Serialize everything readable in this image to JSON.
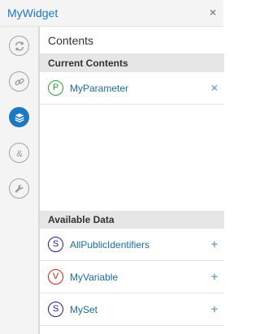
{
  "window": {
    "title": "MyWidget",
    "close_symbol": "×"
  },
  "nav": [
    {
      "name": "refresh-icon",
      "active": false
    },
    {
      "name": "link-icon",
      "active": false
    },
    {
      "name": "layers-icon",
      "active": true
    },
    {
      "name": "ampersand-icon",
      "active": false
    },
    {
      "name": "wrench-icon",
      "active": false
    }
  ],
  "panel": {
    "title": "Contents",
    "current_header": "Current Contents",
    "current_items": [
      {
        "letter": "P",
        "label": "MyParameter",
        "color": "#2e9d3c",
        "action": "×"
      }
    ],
    "available_header": "Available Data",
    "available_items": [
      {
        "letter": "S",
        "label": "AllPublicIdentifiers",
        "color": "#1d1b8f",
        "action": "+"
      },
      {
        "letter": "V",
        "label": "MyVariable",
        "color": "#d61f1f",
        "action": "+"
      },
      {
        "letter": "S",
        "label": "MySet",
        "color": "#1d1b8f",
        "action": "+"
      }
    ]
  },
  "colors": {
    "accent": "#1c78c0",
    "link_text": "#1c6aa8",
    "action": "#7aa9cf"
  }
}
